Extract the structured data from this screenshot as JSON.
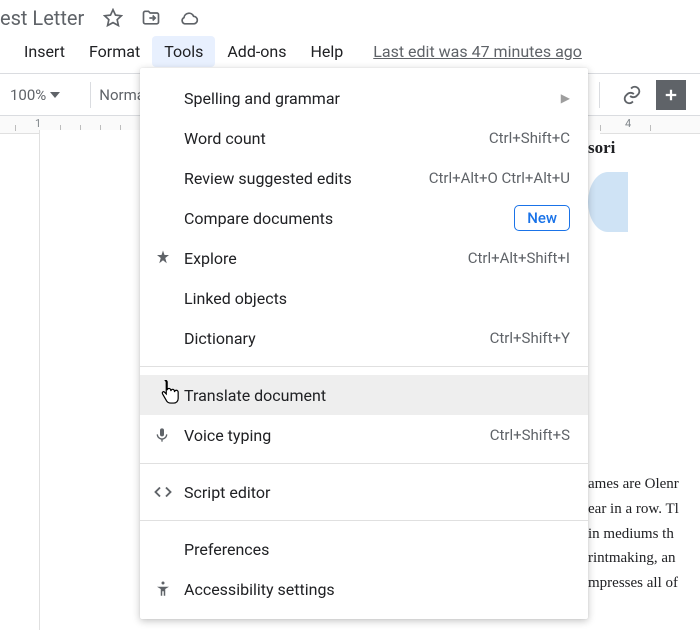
{
  "doc": {
    "title": "est Letter"
  },
  "menubar": {
    "insert": "Insert",
    "format": "Format",
    "tools": "Tools",
    "addons": "Add-ons",
    "help": "Help",
    "last_edit": "Last edit was 47 minutes ago"
  },
  "toolbar": {
    "zoom": "100%",
    "style": "Normal"
  },
  "ruler": {
    "n1": "1",
    "n4": "4"
  },
  "tools_menu": {
    "items": [
      {
        "label": "Spelling and grammar",
        "submenu": true
      },
      {
        "label": "Word count",
        "shortcut": "Ctrl+Shift+C"
      },
      {
        "label": "Review suggested edits",
        "shortcut": "Ctrl+Alt+O Ctrl+Alt+U"
      },
      {
        "label": "Compare documents",
        "badge": "New"
      },
      {
        "label": "Explore",
        "shortcut": "Ctrl+Alt+Shift+I",
        "icon": "explore"
      },
      {
        "label": "Linked objects"
      },
      {
        "label": "Dictionary",
        "shortcut": "Ctrl+Shift+Y"
      }
    ],
    "items2": [
      {
        "label": "Translate document",
        "hovered": true
      },
      {
        "label": "Voice typing",
        "shortcut": "Ctrl+Shift+S",
        "icon": "mic"
      }
    ],
    "items3": [
      {
        "label": "Script editor",
        "icon": "code"
      }
    ],
    "items4": [
      {
        "label": "Preferences"
      },
      {
        "label": "Accessibility settings",
        "icon": "accessibility"
      }
    ]
  },
  "document": {
    "name_fragment": "sori",
    "body_fragment": "ames are Olenr\near in a row. Tl\nin mediums th\nrintmaking, an\nmpresses all of"
  }
}
